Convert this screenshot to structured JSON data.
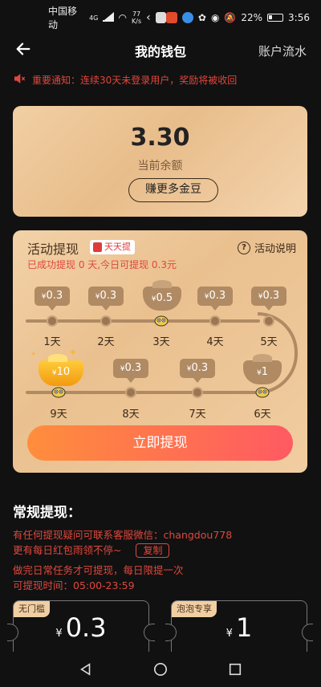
{
  "status_bar": {
    "carrier": "中国移动",
    "net": "4G",
    "speed_value": "77",
    "speed_unit": "K/s",
    "battery": "22%",
    "time": "3:56"
  },
  "header": {
    "title": "我的钱包",
    "right_link": "账户流水"
  },
  "notice": {
    "text": "重要通知：连续30天未登录用户，奖励将被收回"
  },
  "balance": {
    "amount": "3.30",
    "label": "当前余额",
    "earn_button": "赚更多金豆"
  },
  "activity": {
    "title": "活动提现",
    "tag": "天天提",
    "info_link": "活动说明",
    "subtitle": "已成功提现 0 天,今日可提现 0.3元",
    "currency": "¥",
    "days": [
      {
        "label": "1天",
        "amount": "0.3"
      },
      {
        "label": "2天",
        "amount": "0.3"
      },
      {
        "label": "3天",
        "amount": "0.5"
      },
      {
        "label": "4天",
        "amount": "0.3"
      },
      {
        "label": "5天",
        "amount": "0.3"
      },
      {
        "label": "6天",
        "amount": "1"
      },
      {
        "label": "7天",
        "amount": "0.3"
      },
      {
        "label": "8天",
        "amount": "0.3"
      },
      {
        "label": "9天",
        "amount": "10"
      }
    ],
    "withdraw_button": "立即提现"
  },
  "regular": {
    "title": "常规提现：",
    "line1": "有任何提现疑问可联系客服微信：changdou778",
    "line2": "更有每日红包雨领不停~",
    "copy_button": "复制",
    "line3": "做完日常任务才可提现，每日限提一次",
    "line4": "可提现时间：05:00-23:59"
  },
  "coupons": [
    {
      "tag": "无门槛",
      "currency": "¥",
      "amount": "0.3"
    },
    {
      "tag": "泡泡专享",
      "currency": "¥",
      "amount": "1"
    }
  ],
  "colors": {
    "accent_red": "#e0473d",
    "card_gold": "#f1cfa3",
    "button_gradient_start": "#ff8e3c",
    "button_gradient_end": "#ff5a62"
  }
}
